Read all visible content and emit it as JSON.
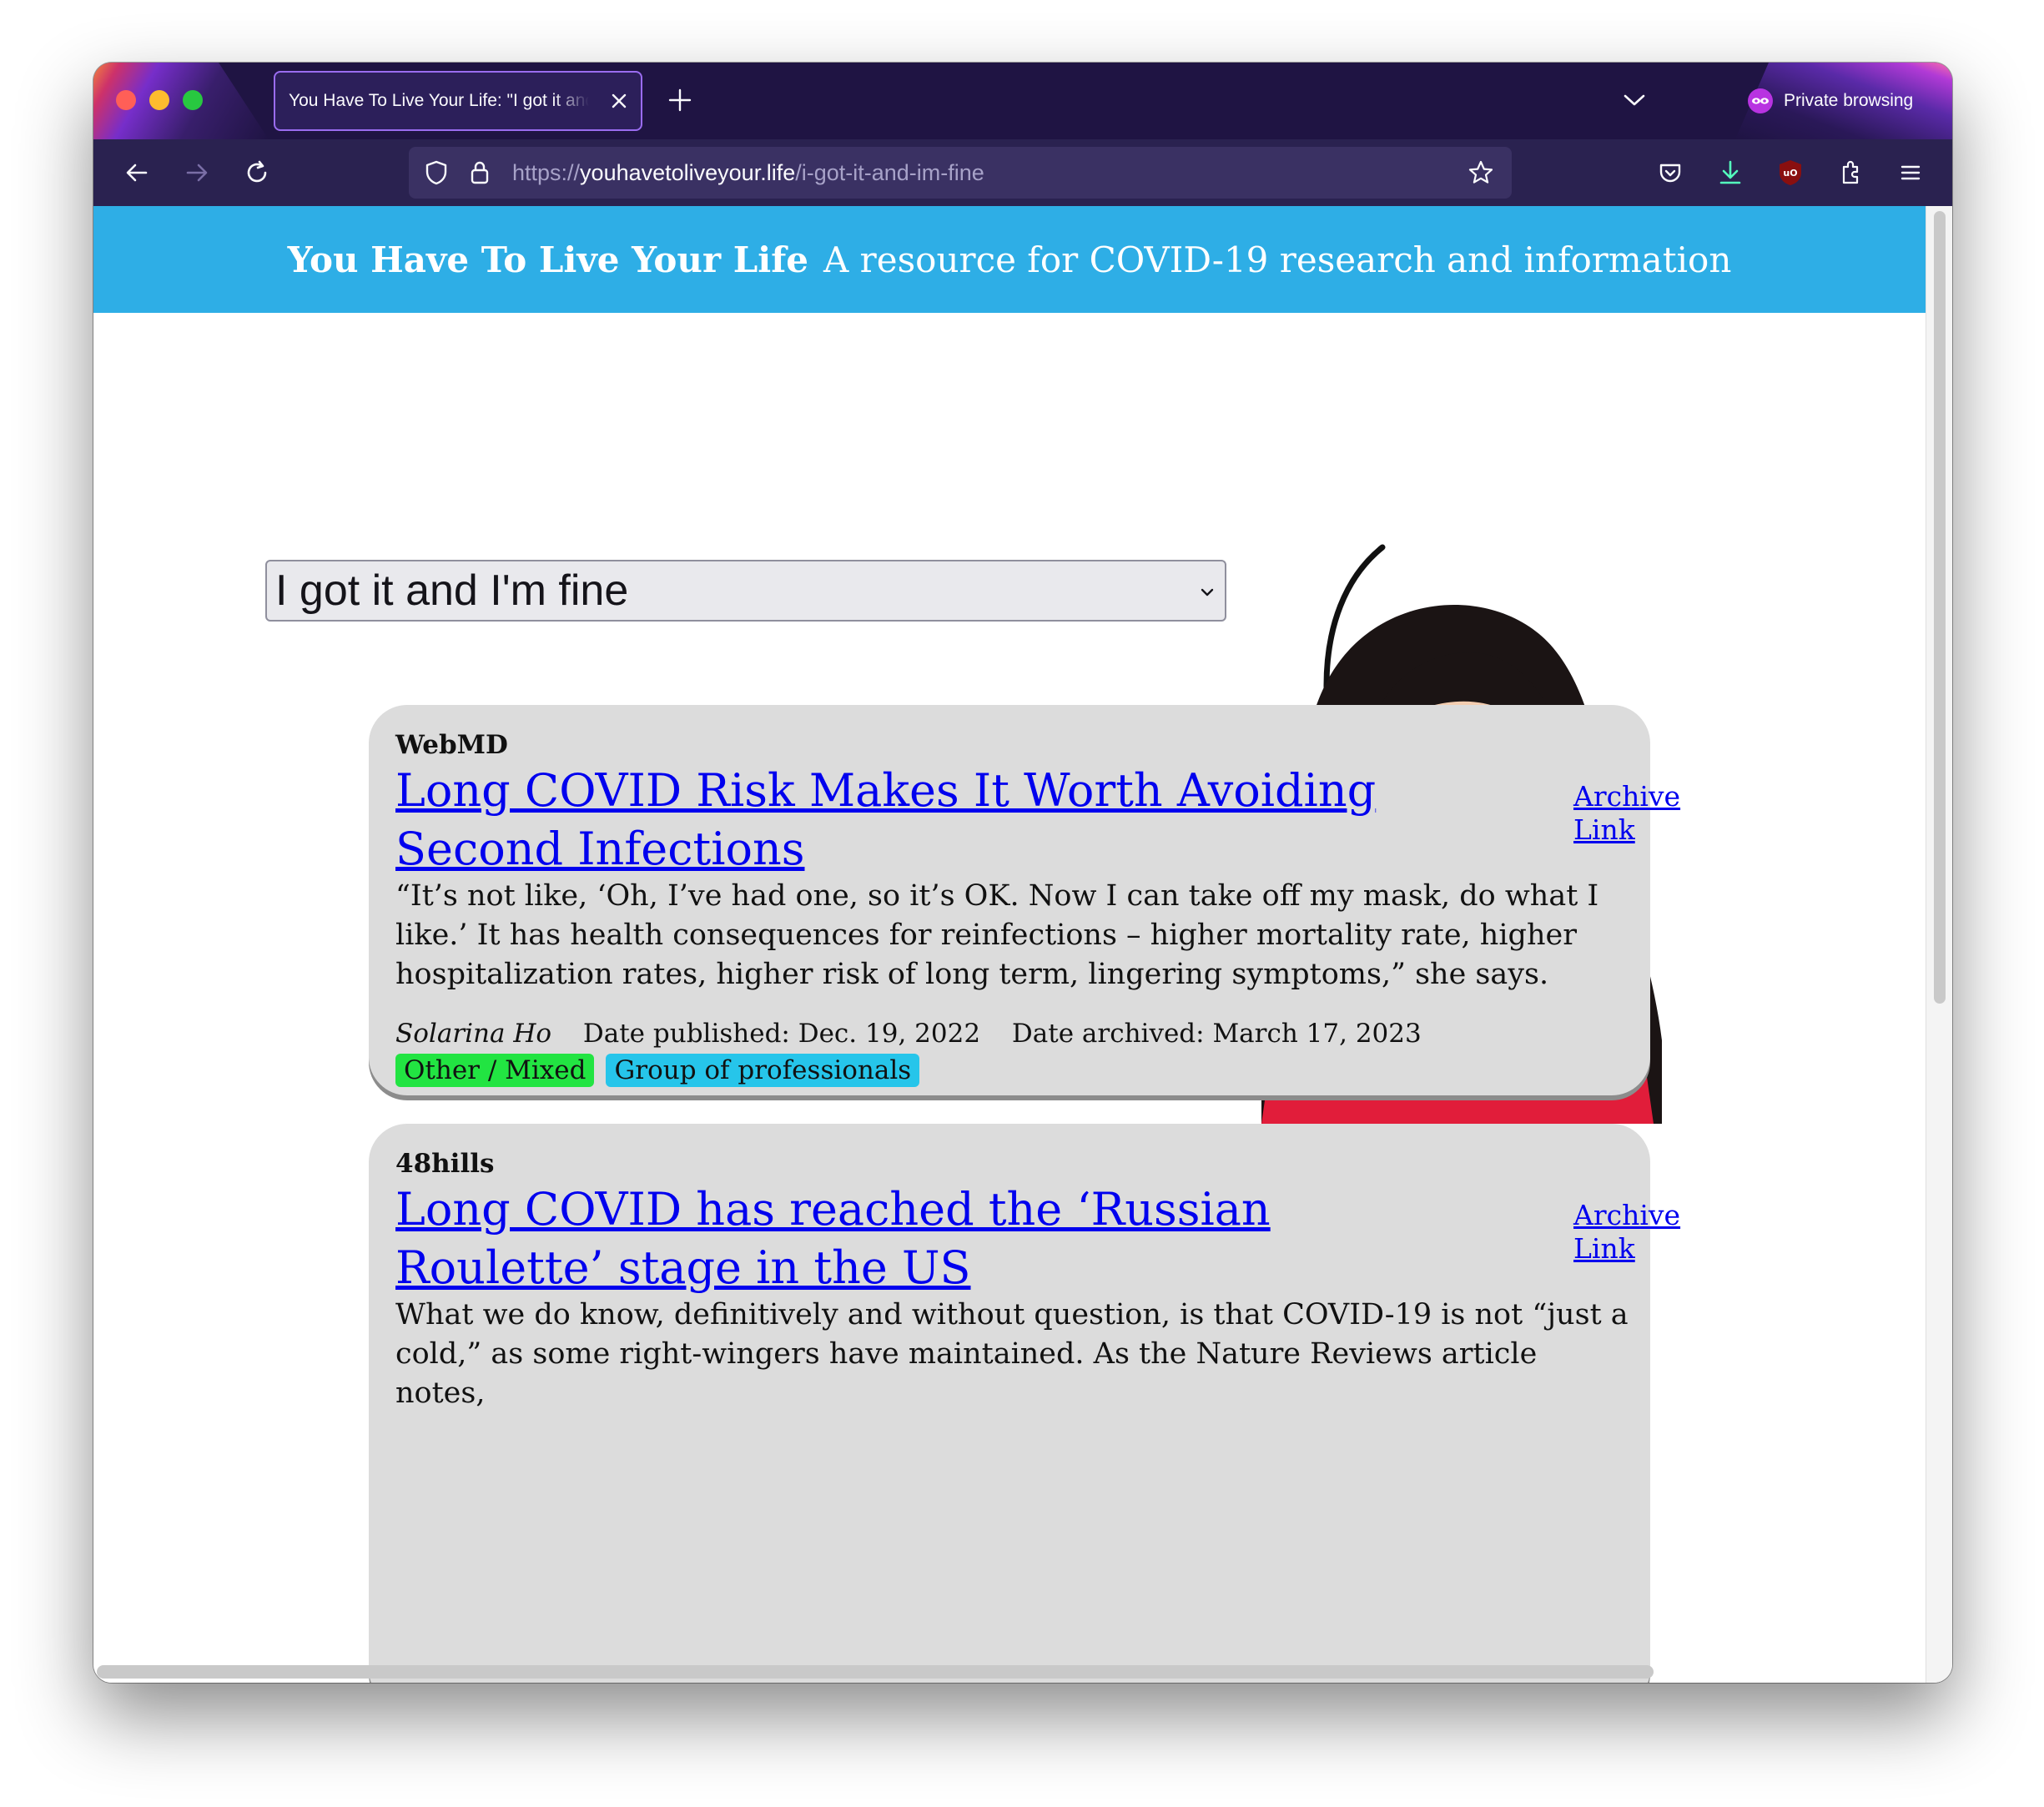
{
  "browser": {
    "tab_title": "You Have To Live Your Life: \"I got it and I'm fine\"",
    "private_label": "Private browsing",
    "url_scheme": "https://",
    "url_host": "youhavetoliveyour.life",
    "url_path": "/i-got-it-and-im-fine"
  },
  "site": {
    "brand": "You Have To Live Your Life",
    "tagline": "A resource for COVID-19 research and information"
  },
  "selector": {
    "value": "I got it and I'm fine"
  },
  "articles": [
    {
      "source": "WebMD",
      "title": "Long COVID Risk Makes It Worth Avoiding Second Infections",
      "archive_label": "Archive Link",
      "quote": "“It’s not like, ‘Oh, I’ve had one, so it’s OK. Now I can take off my mask, do what I like.’ It has health consequences for reinfections – higher mortality rate, higher hospitalization rates, higher risk of long term, lingering symptoms,” she says.",
      "author": "Solarina Ho",
      "date_published": "Date published: Dec. 19, 2022",
      "date_archived": "Date archived: March 17, 2023",
      "tags": [
        "Other / Mixed",
        "Group of professionals"
      ]
    },
    {
      "source": "48hills",
      "title": "Long COVID has reached the ‘Russian Roulette’ stage in the US",
      "archive_label": "Archive Link",
      "quote": "What we do know, definitively and without question, is that COVID-19 is not “just a cold,” as some right-wingers have maintained. As the Nature Reviews article notes,"
    }
  ],
  "colors": {
    "header_bg": "#2eaee6",
    "link": "#0000ee",
    "card_bg": "#dcdcdc",
    "tag_green": "#22e442",
    "tag_blue": "#26c5ea"
  },
  "icons": [
    "back-arrow-icon",
    "forward-arrow-icon",
    "reload-icon",
    "shield-icon",
    "lock-icon",
    "star-icon",
    "pocket-icon",
    "download-icon",
    "ublock-icon",
    "extensions-icon",
    "menu-icon",
    "private-mask-icon",
    "close-icon",
    "plus-icon",
    "chevron-down-icon"
  ]
}
